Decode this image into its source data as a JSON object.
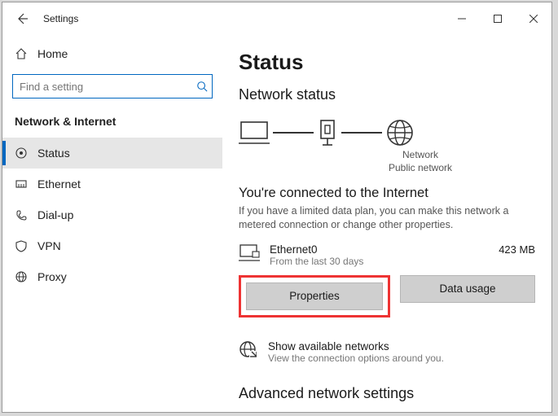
{
  "titlebar": {
    "title": "Settings"
  },
  "sidebar": {
    "home_label": "Home",
    "search_placeholder": "Find a setting",
    "section_label": "Network & Internet",
    "items": [
      {
        "label": "Status"
      },
      {
        "label": "Ethernet"
      },
      {
        "label": "Dial-up"
      },
      {
        "label": "VPN"
      },
      {
        "label": "Proxy"
      }
    ]
  },
  "main": {
    "page_title": "Status",
    "section_title": "Network status",
    "diagram": {
      "node_label": "Network",
      "node_sublabel": "Public network"
    },
    "status_headline": "You're connected to the Internet",
    "status_description": "If you have a limited data plan, you can make this network a metered connection or change other properties.",
    "connection": {
      "name": "Ethernet0",
      "subtext": "From the last 30 days",
      "usage": "423 MB"
    },
    "buttons": {
      "properties": "Properties",
      "data_usage": "Data usage"
    },
    "available": {
      "title": "Show available networks",
      "subtitle": "View the connection options around you."
    },
    "advanced_heading": "Advanced network settings"
  }
}
